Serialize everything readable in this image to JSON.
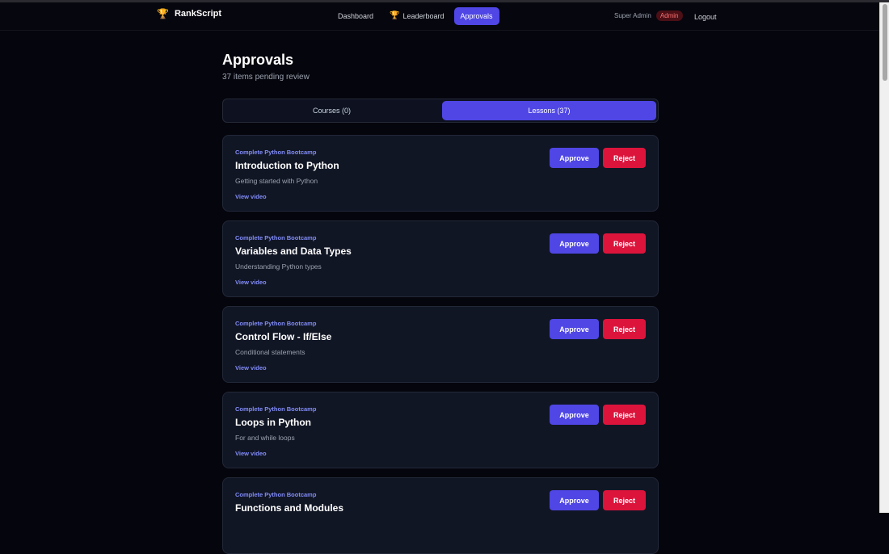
{
  "brand": {
    "name": "RankScript",
    "icon": "trophy-icon"
  },
  "nav": {
    "links": [
      {
        "label": "Dashboard"
      },
      {
        "label": "Leaderboard",
        "icon": "trophy-icon"
      },
      {
        "label": "Approvals",
        "active": true
      }
    ],
    "user_name": "Super Admin",
    "role_badge": "Admin",
    "logout_label": "Logout"
  },
  "page": {
    "title": "Approvals",
    "subtitle": "37 items pending review"
  },
  "tabs": [
    {
      "label": "Courses (0)",
      "active": false
    },
    {
      "label": "Lessons (37)",
      "active": true
    }
  ],
  "lessons": [
    {
      "course": "Complete Python Bootcamp",
      "title": "Introduction to Python",
      "description": "Getting started with Python",
      "link": "View video",
      "approve": "Approve",
      "reject": "Reject"
    },
    {
      "course": "Complete Python Bootcamp",
      "title": "Variables and Data Types",
      "description": "Understanding Python types",
      "link": "View video",
      "approve": "Approve",
      "reject": "Reject"
    },
    {
      "course": "Complete Python Bootcamp",
      "title": "Control Flow - If/Else",
      "description": "Conditional statements",
      "link": "View video",
      "approve": "Approve",
      "reject": "Reject"
    },
    {
      "course": "Complete Python Bootcamp",
      "title": "Loops in Python",
      "description": "For and while loops",
      "link": "View video",
      "approve": "Approve",
      "reject": "Reject"
    },
    {
      "course": "Complete Python Bootcamp",
      "title": "Functions and Modules",
      "description": "",
      "link": "",
      "approve": "Approve",
      "reject": "Reject"
    }
  ],
  "colors": {
    "accent": "#4f46e5",
    "danger": "#dc143c",
    "background": "#05050d",
    "card": "#111625"
  }
}
